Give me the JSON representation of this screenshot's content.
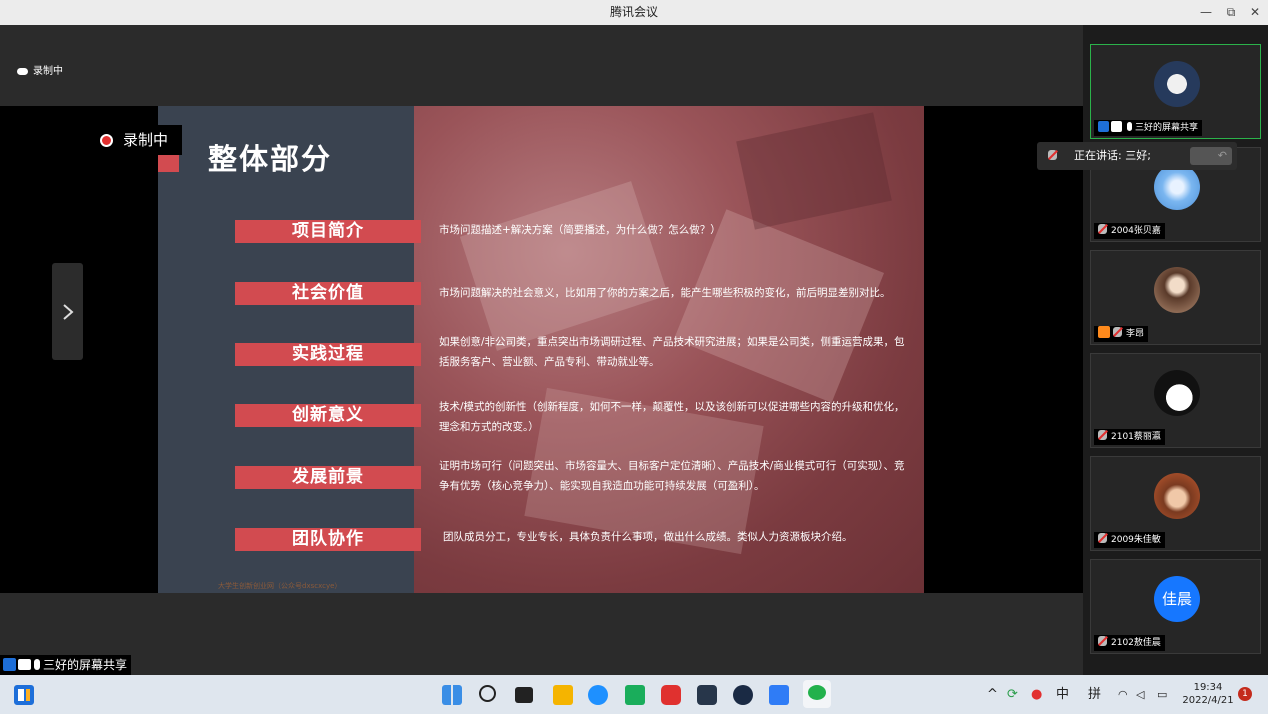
{
  "window": {
    "title": "腾讯会议",
    "minimize": "—",
    "restore": "⧉",
    "close": "✕"
  },
  "recording": {
    "top_label": "录制中",
    "slide_label": "录制中"
  },
  "slide": {
    "title": "整体部分",
    "rows": [
      {
        "label": "项目简介",
        "desc": "市场问题描述+解决方案（简要播述，为什么做？怎么做？）"
      },
      {
        "label": "社会价值",
        "desc": "市场问题解决的社会意义，比如用了你的方案之后，能产生哪些积极的变化，前后明显差别对比。"
      },
      {
        "label": "实践过程",
        "desc": "如果创意/非公司类，重点突出市场调研过程、产品技术研究进展；如果是公司类，侧重运营成果，包括服务客户、营业额、产品专利、带动就业等。"
      },
      {
        "label": "创新意义",
        "desc": "技术/模式的创新性（创新程度，如何不一样，颠覆性，以及该创新可以促进哪些内容的升级和优化，理念和方式的改变。）"
      },
      {
        "label": "发展前景",
        "desc": "证明市场可行（问题突出、市场容量大、目标客户定位清晰）、产品技术/商业模式可行（可实现）、竞争有优势（核心竞争力）、能实现自我造血功能可持续发展（可盈利）。"
      },
      {
        "label": "团队协作",
        "desc": "团队成员分工，专业专长，具体负责什么事项，做出什么成绩。类似人力资源板块介绍。"
      }
    ],
    "watermark": "大学生创新创业网（公众号dxscxcye）"
  },
  "share_tag": "三好的屏幕共享",
  "speaking": {
    "label": "正在讲话: 三好;"
  },
  "participants": [
    {
      "name": "三好的屏幕共享",
      "avatar": "photo"
    },
    {
      "name": "2004张贝嘉",
      "avatar": "photo"
    },
    {
      "name": "李昂",
      "avatar": "photo"
    },
    {
      "name": "2101蔡丽瀛",
      "avatar": "photo"
    },
    {
      "name": "2009朱佳敏",
      "avatar": "photo"
    },
    {
      "name": "2102敖佳晨",
      "avatar_text": "佳晨",
      "avatar_color": "#1677ff"
    }
  ],
  "taskbar": {
    "ime_mode": "中",
    "ime_name": "拼",
    "time": "19:34",
    "date": "2022/4/21",
    "notification_count": "1",
    "tray_up": "^"
  }
}
